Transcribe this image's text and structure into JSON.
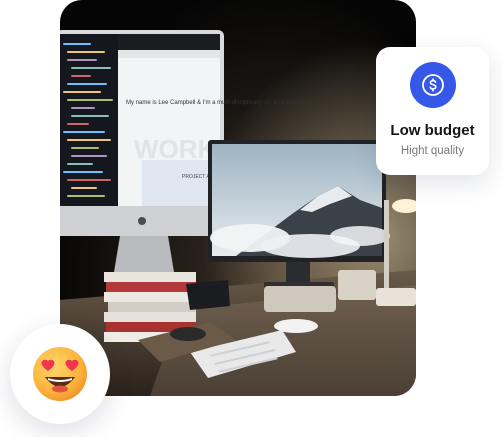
{
  "budget_card": {
    "title": "Low budget",
    "subtitle": "Hight quality",
    "icon": "dollar-coin-icon",
    "accent_color": "#3658e8"
  },
  "photo": {
    "screen_headline": "My name is Lee Campbell & I'm a multi-disciplinary UX & UI Designer.",
    "screen_big_word": "WORK",
    "screen_project_label": "PROJECT A"
  },
  "emoji": {
    "icon": "heart-eyes-emoji-icon"
  }
}
